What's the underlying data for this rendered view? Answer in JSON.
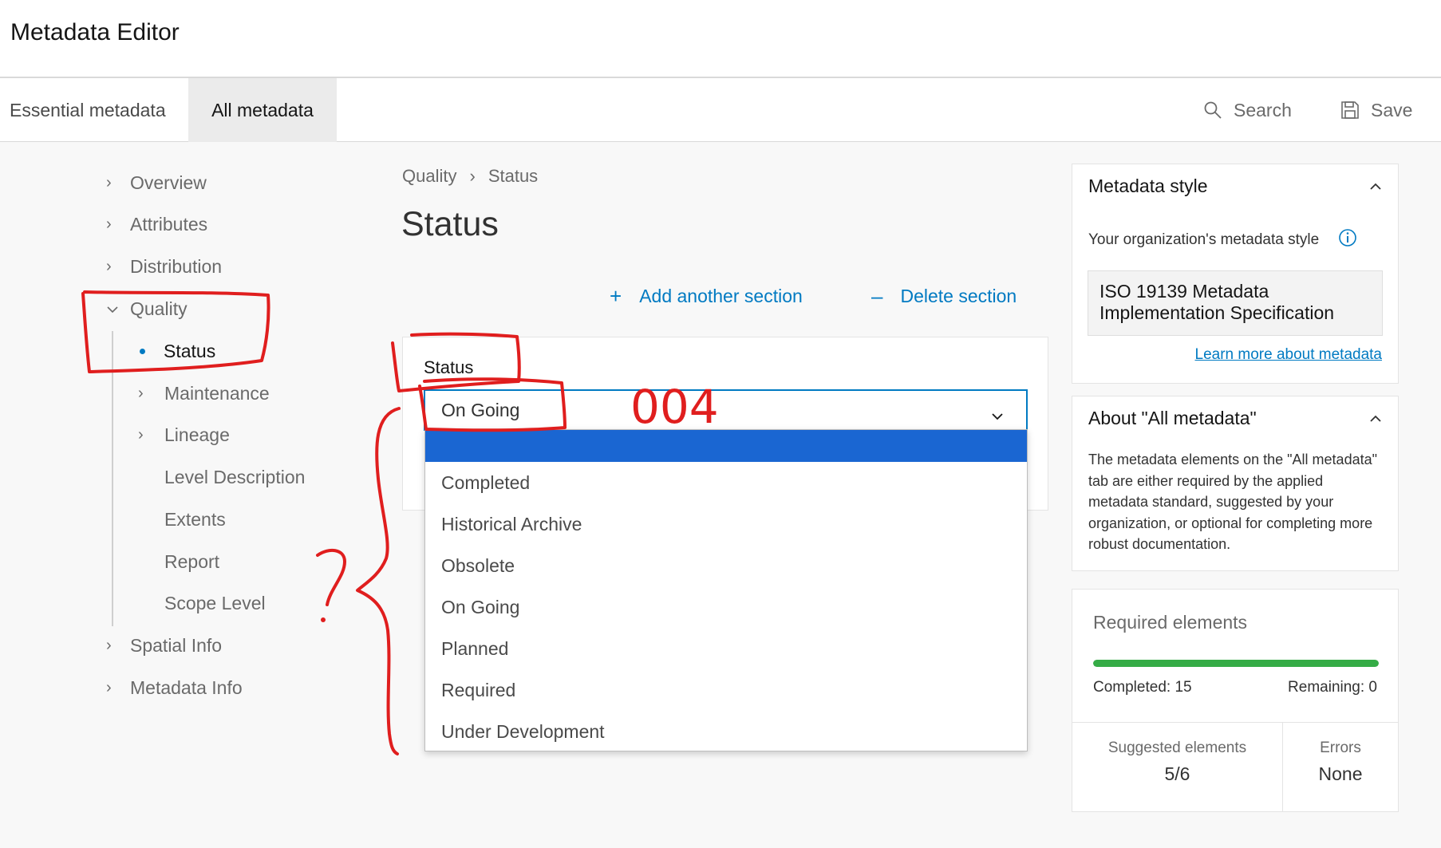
{
  "app": {
    "title": "Metadata Editor"
  },
  "tabs": [
    {
      "label": "Essential metadata"
    },
    {
      "label": "All metadata"
    }
  ],
  "toolbar": {
    "search_label": "Search",
    "save_label": "Save",
    "search_icon": "search-icon",
    "save_icon": "floppy-disk-icon"
  },
  "nav": {
    "items": [
      {
        "label": "Overview"
      },
      {
        "label": "Attributes"
      },
      {
        "label": "Distribution"
      },
      {
        "label": "Quality"
      },
      {
        "label": "Spatial Info"
      },
      {
        "label": "Metadata Info"
      }
    ],
    "quality_children": [
      {
        "label": "Status"
      },
      {
        "label": "Maintenance"
      },
      {
        "label": "Lineage"
      },
      {
        "label": "Level Description"
      },
      {
        "label": "Extents"
      },
      {
        "label": "Report"
      },
      {
        "label": "Scope Level"
      }
    ]
  },
  "breadcrumb": {
    "parent": "Quality",
    "current": "Status"
  },
  "page": {
    "title": "Status",
    "add_section": "Add another section",
    "delete_section": "Delete section"
  },
  "status_field": {
    "label": "Status",
    "value": "On Going",
    "options": [
      "Completed",
      "Historical Archive",
      "Obsolete",
      "On Going",
      "Planned",
      "Required",
      "Under Development"
    ]
  },
  "metadata_style": {
    "title": "Metadata style",
    "org_label": "Your organization's metadata style",
    "value": "ISO 19139 Metadata Implementation Specification",
    "learn_more": "Learn more about metadata"
  },
  "about": {
    "title": "About \"All metadata\"",
    "text": "The metadata elements on the \"All metadata\" tab are either required by the applied metadata standard, suggested by your organization, or optional for completing more robust documentation."
  },
  "required": {
    "title": "Required elements",
    "completed_label": "Completed: 15",
    "remaining_label": "Remaining: 0",
    "progress_fraction": 1.0,
    "suggested_label": "Suggested elements",
    "suggested_value": "5/6",
    "errors_label": "Errors",
    "errors_value": "None"
  },
  "annotation": {
    "handwritten_text": "004",
    "question_mark": "?",
    "color": "#e01e1e"
  },
  "colors": {
    "accent": "#007ac2",
    "highlight": "#1a66d2",
    "progress": "#35ac46"
  }
}
